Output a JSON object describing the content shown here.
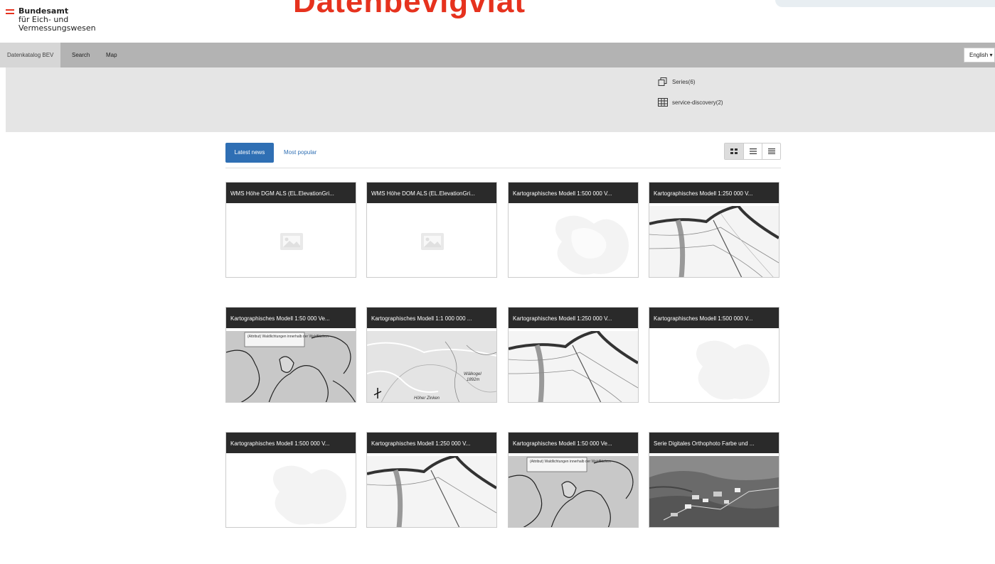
{
  "header": {
    "logo_line1": "Bundesamt",
    "logo_line2": "für Eich- und",
    "logo_line3": "Vermessungswesen",
    "big_title": "Datenbevigviat"
  },
  "nav": {
    "items": [
      {
        "label": "Datenkatalog BEV",
        "active": true
      },
      {
        "label": "Search",
        "active": false
      },
      {
        "label": "Map",
        "active": false
      }
    ],
    "language": "English"
  },
  "topics": [
    {
      "label": "Series(6)",
      "icon": "copy-icon"
    },
    {
      "label": "service-discovery(2)",
      "icon": "table-icon"
    }
  ],
  "tabs": {
    "latest": "Latest news",
    "popular": "Most popular"
  },
  "view_modes": [
    "grid-view-icon",
    "list-view-icon",
    "compact-list-icon"
  ],
  "cards": [
    {
      "title": "WMS Höhe DGM ALS (EL.ElevationGri...",
      "thumb": "placeholder"
    },
    {
      "title": "WMS Höhe DOM ALS (EL.ElevationGri...",
      "thumb": "placeholder"
    },
    {
      "title": "Kartographisches Modell 1:500 000 V...",
      "thumb": "faint"
    },
    {
      "title": "Kartographisches Modell 1:250 000 V...",
      "thumb": "road"
    },
    {
      "title": "Kartographisches Modell 1:50 000 Ve...",
      "thumb": "contour",
      "label": "(Attribut) Waldlichtungen innerhalb der Waldflächen"
    },
    {
      "title": "Kartographisches Modell 1:1 000 000 ...",
      "thumb": "topo",
      "label": "Höher Zinken"
    },
    {
      "title": "Kartographisches Modell 1:250 000 V...",
      "thumb": "road"
    },
    {
      "title": "Kartographisches Modell 1:500 000 V...",
      "thumb": "faint"
    },
    {
      "title": "Kartographisches Modell 1:500 000 V...",
      "thumb": "faint"
    },
    {
      "title": "Kartographisches Modell 1:250 000 V...",
      "thumb": "road"
    },
    {
      "title": "Kartographisches Modell 1:50 000 Ve...",
      "thumb": "contour",
      "label": "(Attribut) Waldlichtungen innerhalb der Waldflächen"
    },
    {
      "title": "Serie Digitales Orthophoto Farbe und ...",
      "thumb": "ortho"
    }
  ]
}
